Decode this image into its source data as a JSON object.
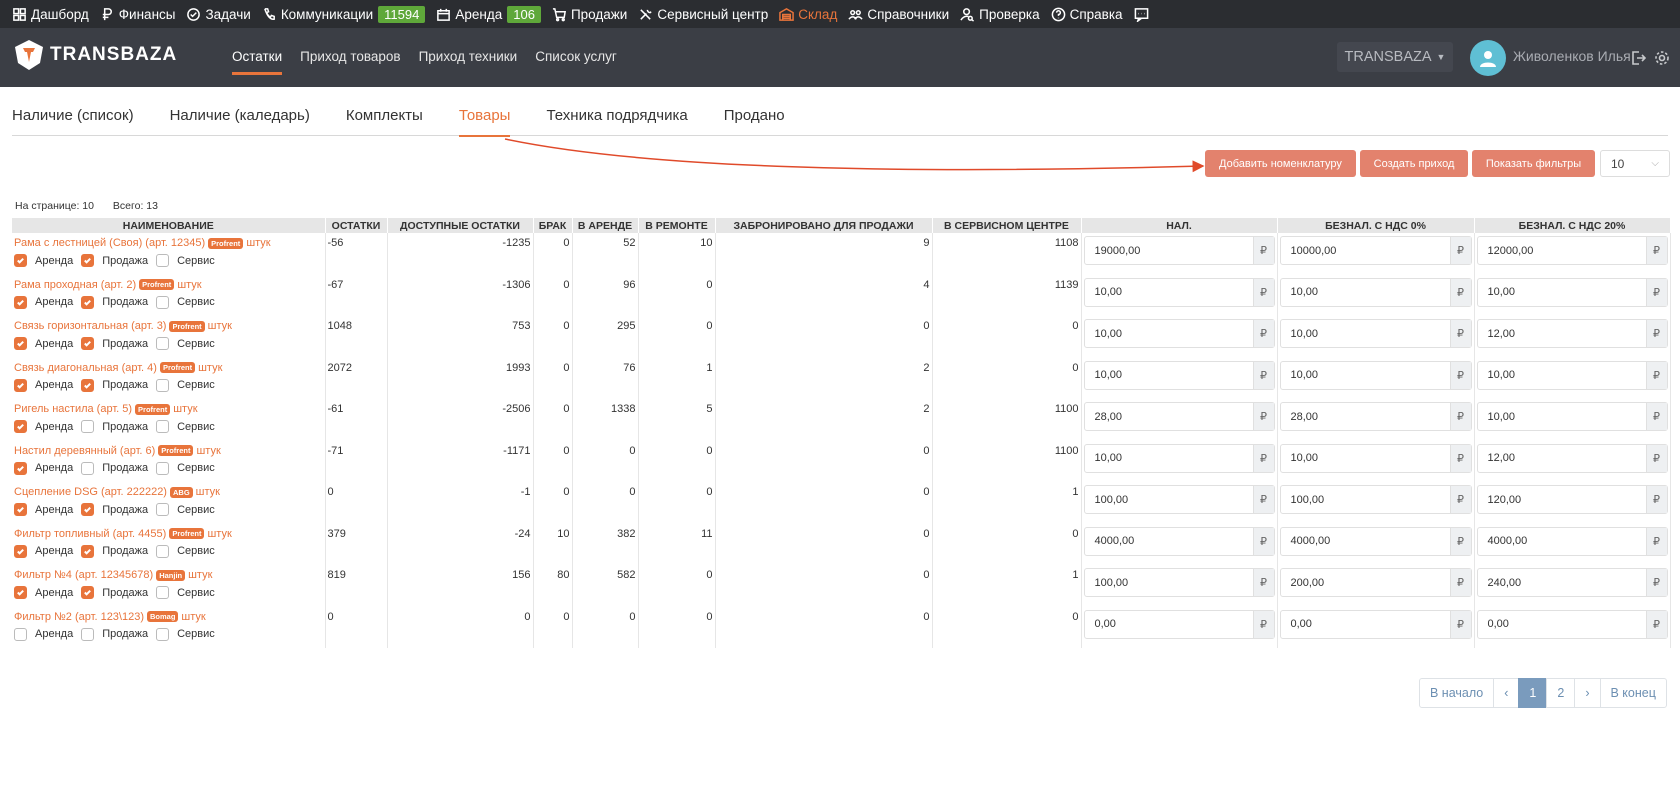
{
  "topbar": {
    "items": [
      {
        "label": "Дашборд",
        "icon": "dashboard-icon"
      },
      {
        "label": "Финансы",
        "icon": "ruble-icon"
      },
      {
        "label": "Задачи",
        "icon": "check-circle-icon"
      },
      {
        "label": "Коммуникации",
        "icon": "phone-icon",
        "badge": "11594"
      },
      {
        "label": "Аренда",
        "icon": "calendar-icon",
        "badge": "106"
      },
      {
        "label": "Продажи",
        "icon": "cart-icon"
      },
      {
        "label": "Сервисный центр",
        "icon": "tools-icon"
      },
      {
        "label": "Склад",
        "icon": "warehouse-icon",
        "active": true
      },
      {
        "label": "Справочники",
        "icon": "users-icon"
      },
      {
        "label": "Проверка",
        "icon": "user-search-icon"
      },
      {
        "label": "Справка",
        "icon": "help-icon"
      }
    ],
    "chat_icon": "chat-icon"
  },
  "header": {
    "logo_text": "TRANSBAZA",
    "nav": [
      "Остатки",
      "Приход товаров",
      "Приход техники",
      "Список услуг"
    ],
    "nav_active": 0,
    "company": "TRANSBAZA",
    "user_name": "Живоленков Илья"
  },
  "tabs": [
    "Наличие (список)",
    "Наличие (каледарь)",
    "Комплекты",
    "Товары",
    "Техника подрядчика",
    "Продано"
  ],
  "tab_active": 3,
  "buttons": {
    "add_nomenclature": "Добавить номенклатуру",
    "create_income": "Создать приход",
    "show_filters": "Показать фильтры"
  },
  "per_page": "10",
  "stats": {
    "on_page": "На странице: 10",
    "total": "Всего: 13"
  },
  "table": {
    "headers": [
      "Наименование",
      "Остатки",
      "Доступные остатки",
      "Брак",
      "В аренде",
      "В ремонте",
      "Забронировано для продажи",
      "В сервисном центре",
      "Нал.",
      "Безнал. с НДС 0%",
      "Безнал. с НДС 20%"
    ],
    "currency": "₽",
    "check_labels": [
      "Аренда",
      "Продажа",
      "Сервис"
    ],
    "rows": [
      {
        "name": "Рама с лестницей (Своя) (арт. 12345)",
        "brand": "Profrent",
        "unit": "штук",
        "rent": true,
        "sale": true,
        "service": false,
        "stock": "-56",
        "available": "-1235",
        "defect": "0",
        "in_rent": "52",
        "in_repair": "10",
        "reserved": "9",
        "in_service": "1108",
        "cash": "19000,00",
        "vat0": "10000,00",
        "vat20": "12000,00"
      },
      {
        "name": "Рама проходная (арт. 2)",
        "brand": "Profrent",
        "unit": "штук",
        "rent": true,
        "sale": true,
        "service": false,
        "stock": "-67",
        "available": "-1306",
        "defect": "0",
        "in_rent": "96",
        "in_repair": "0",
        "reserved": "4",
        "in_service": "1139",
        "cash": "10,00",
        "vat0": "10,00",
        "vat20": "10,00"
      },
      {
        "name": "Связь горизонтальная (арт. 3)",
        "brand": "Profrent",
        "unit": "штук",
        "rent": true,
        "sale": true,
        "service": false,
        "stock": "1048",
        "available": "753",
        "defect": "0",
        "in_rent": "295",
        "in_repair": "0",
        "reserved": "0",
        "in_service": "0",
        "cash": "10,00",
        "vat0": "10,00",
        "vat20": "12,00"
      },
      {
        "name": "Связь диагональная (арт. 4)",
        "brand": "Profrent",
        "unit": "штук",
        "rent": true,
        "sale": true,
        "service": false,
        "stock": "2072",
        "available": "1993",
        "defect": "0",
        "in_rent": "76",
        "in_repair": "1",
        "reserved": "2",
        "in_service": "0",
        "cash": "10,00",
        "vat0": "10,00",
        "vat20": "10,00"
      },
      {
        "name": "Ригель настила (арт. 5)",
        "brand": "Profrent",
        "unit": "штук",
        "rent": true,
        "sale": false,
        "service": false,
        "stock": "-61",
        "available": "-2506",
        "defect": "0",
        "in_rent": "1338",
        "in_repair": "5",
        "reserved": "2",
        "in_service": "1100",
        "cash": "28,00",
        "vat0": "28,00",
        "vat20": "10,00"
      },
      {
        "name": "Настил деревянный (арт. 6)",
        "brand": "Profrent",
        "unit": "штук",
        "rent": true,
        "sale": false,
        "service": false,
        "stock": "-71",
        "available": "-1171",
        "defect": "0",
        "in_rent": "0",
        "in_repair": "0",
        "reserved": "0",
        "in_service": "1100",
        "cash": "10,00",
        "vat0": "10,00",
        "vat20": "12,00"
      },
      {
        "name": "Сцепление DSG (арт. 222222)",
        "brand": "ABG",
        "unit": "штук",
        "rent": true,
        "sale": true,
        "service": false,
        "stock": "0",
        "available": "-1",
        "defect": "0",
        "in_rent": "0",
        "in_repair": "0",
        "reserved": "0",
        "in_service": "1",
        "cash": "100,00",
        "vat0": "100,00",
        "vat20": "120,00"
      },
      {
        "name": "Фильтр топливный (арт. 4455)",
        "brand": "Profrent",
        "unit": "штук",
        "rent": true,
        "sale": true,
        "service": false,
        "stock": "379",
        "available": "-24",
        "defect": "10",
        "in_rent": "382",
        "in_repair": "11",
        "reserved": "0",
        "in_service": "0",
        "cash": "4000,00",
        "vat0": "4000,00",
        "vat20": "4000,00"
      },
      {
        "name": "Фильтр №4 (арт. 12345678)",
        "brand": "Hanjin",
        "unit": "штук",
        "rent": true,
        "sale": true,
        "service": false,
        "stock": "819",
        "available": "156",
        "defect": "80",
        "in_rent": "582",
        "in_repair": "0",
        "reserved": "0",
        "in_service": "1",
        "cash": "100,00",
        "vat0": "200,00",
        "vat20": "240,00"
      },
      {
        "name": "Фильтр №2 (арт. 123\\123)",
        "brand": "Bomag",
        "unit": "штук",
        "rent": false,
        "sale": false,
        "service": false,
        "stock": "0",
        "available": "0",
        "defect": "0",
        "in_rent": "0",
        "in_repair": "0",
        "reserved": "0",
        "in_service": "0",
        "cash": "0,00",
        "vat0": "0,00",
        "vat20": "0,00"
      }
    ]
  },
  "pagination": {
    "first": "В начало",
    "prev": "‹",
    "pages": [
      "1",
      "2"
    ],
    "active": "1",
    "next": "›",
    "last": "В конец"
  },
  "colors": {
    "accent": "#e8743b",
    "button": "#e3826d",
    "badge": "#5fa83a",
    "topbar": "#2b2d31",
    "header": "#3b3e45"
  }
}
